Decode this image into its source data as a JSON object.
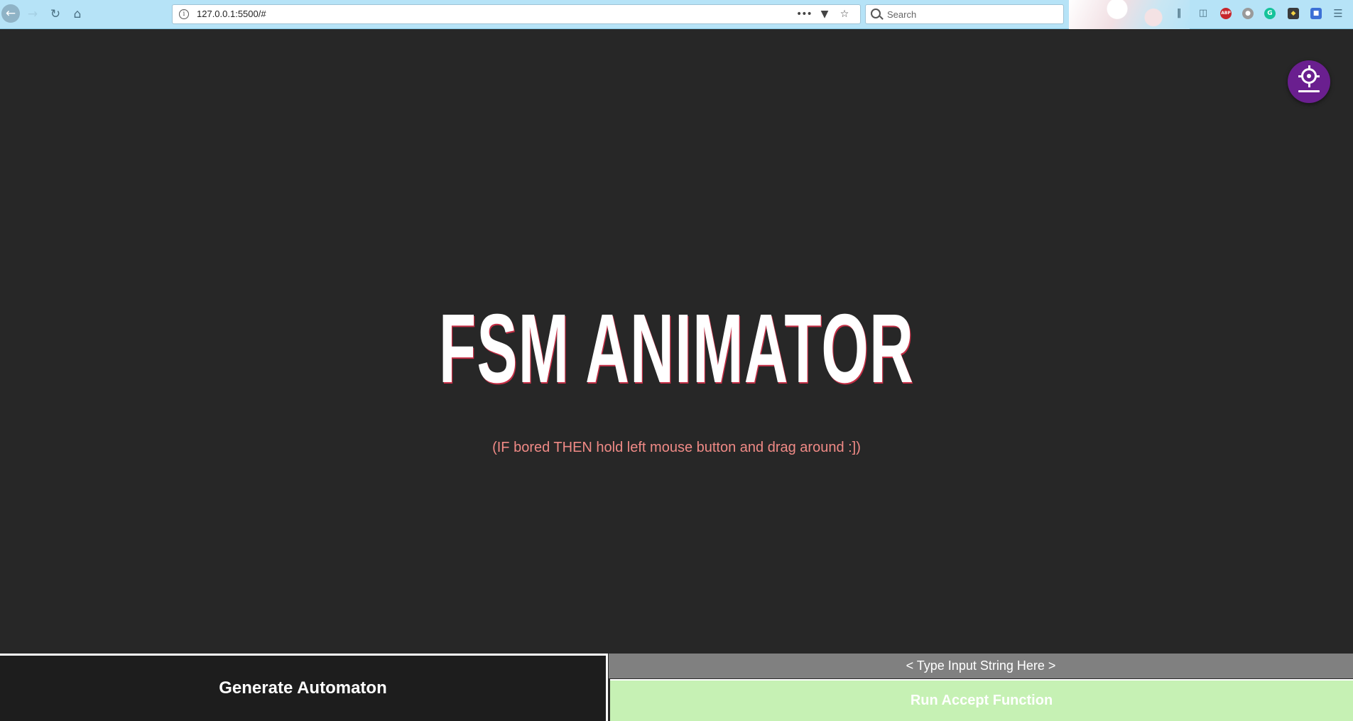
{
  "browser": {
    "url": "127.0.0.1:5500/#",
    "search_placeholder": "Search",
    "extensions": {
      "abp_label": "ABP",
      "grammarly_label": "G"
    }
  },
  "icons": {
    "back": "back-arrow-icon",
    "forward": "forward-arrow-icon",
    "reload": "reload-icon",
    "home": "home-icon",
    "info": "info-icon",
    "more": "more-dots-icon",
    "pocket": "pocket-icon",
    "bookmark": "star-icon",
    "search": "search-icon",
    "settings": "settings-gear-icon"
  },
  "page": {
    "title": "FSM ANIMATOR",
    "hint": "(IF bored THEN hold left mouse button and drag around :])",
    "generate_label": "Generate Automaton",
    "input_placeholder": "< Type Input String Here >",
    "input_value": "",
    "run_label": "Run Accept Function"
  },
  "colors": {
    "background": "#272727",
    "title": "#ffffff",
    "title_shadow": "#c62f46",
    "hint": "#f08a86",
    "settings_button": "#6a1f8f",
    "generate_bg": "#1d1d1d",
    "input_bg": "#808080",
    "run_bg": "#c6f1b4",
    "toolbar": "#b6e3f7"
  }
}
